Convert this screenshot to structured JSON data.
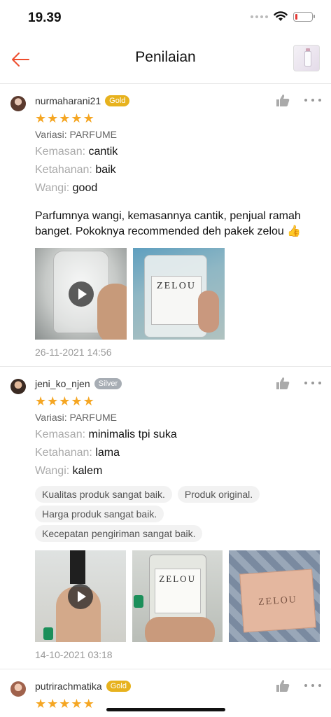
{
  "status_bar": {
    "time": "19.39",
    "battery_level": 0.15
  },
  "header": {
    "title": "Penilaian",
    "back_icon": "arrow-left-icon",
    "thumb_icon": "product-thumbnail"
  },
  "colors": {
    "accent": "#ee4d2d",
    "star": "#f5a623",
    "gold_badge": "#e7b21e",
    "silver_badge": "#a7adb4"
  },
  "reviews": [
    {
      "username": "nurmaharani21",
      "badge": "Gold",
      "rating": 5,
      "variation": "Variasi: PARFUME",
      "attributes": [
        {
          "label": "Kemasan:",
          "value": "cantik"
        },
        {
          "label": "Ketahanan:",
          "value": "baik"
        },
        {
          "label": "Wangi:",
          "value": "good"
        }
      ],
      "comment": "Parfumnya wangi, kemasannya cantik, penjual ramah banget. Pokoknya recommended deh pakek zelou 👍",
      "photo_texts": [
        "ZELOU"
      ],
      "date": "26-11-2021 14:56"
    },
    {
      "username": "jeni_ko_njen",
      "badge": "Silver",
      "rating": 5,
      "variation": "Variasi: PARFUME",
      "attributes": [
        {
          "label": "Kemasan:",
          "value": "minimalis tpi suka"
        },
        {
          "label": "Ketahanan:",
          "value": "lama"
        },
        {
          "label": "Wangi:",
          "value": "kalem"
        }
      ],
      "tags": [
        "Kualitas produk sangat baik.",
        "Produk original.",
        "Harga produk sangat baik.",
        "Kecepatan pengiriman sangat baik."
      ],
      "photo_texts": [
        "ZELOU",
        "ZELOU"
      ],
      "date": "14-10-2021 03:18"
    },
    {
      "username": "putrirachmatika",
      "badge": "Gold",
      "rating": 5
    }
  ]
}
